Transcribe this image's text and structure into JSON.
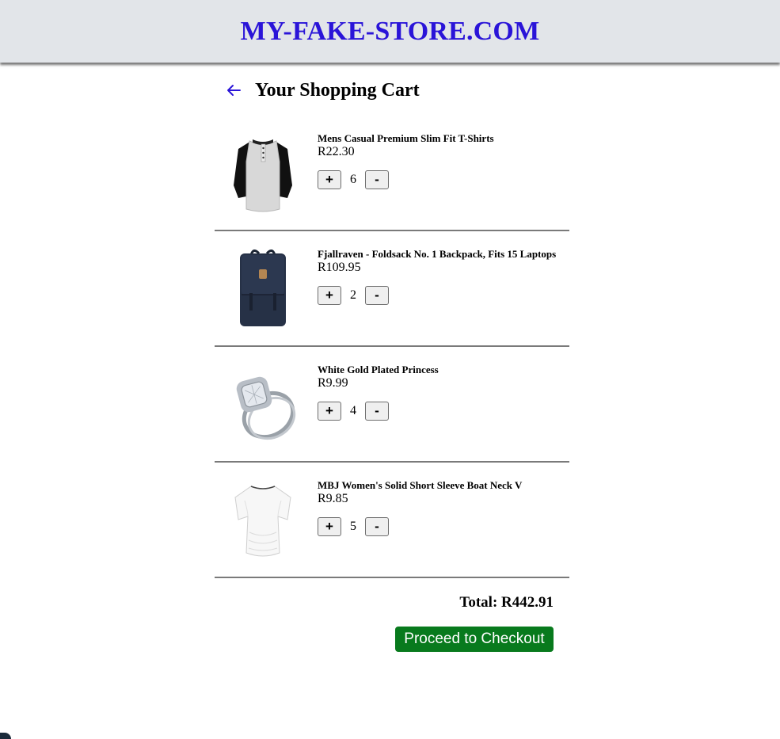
{
  "header": {
    "brand": "MY-FAKE-STORE.COM"
  },
  "cart": {
    "title": "Your Shopping Cart",
    "items": [
      {
        "name": "Mens Casual Premium Slim Fit T-Shirts",
        "price": "R22.30",
        "quantity": "6",
        "image": "raglan-henley-shirt"
      },
      {
        "name": "Fjallraven - Foldsack No. 1 Backpack, Fits 15 Laptops",
        "price": "R109.95",
        "quantity": "2",
        "image": "navy-backpack"
      },
      {
        "name": "White Gold Plated Princess",
        "price": "R9.99",
        "quantity": "4",
        "image": "diamond-ring"
      },
      {
        "name": "MBJ Women's Solid Short Sleeve Boat Neck V",
        "price": "R9.85",
        "quantity": "5",
        "image": "white-womens-top"
      }
    ],
    "plus_label": "+",
    "minus_label": "-",
    "total": "Total: R442.91",
    "checkout_label": "Proceed to Checkout"
  },
  "colors": {
    "brand": "#2a14d8",
    "header_bg": "#e2e5e9",
    "checkout_bg": "#087a1d",
    "divider": "#7a7a7a"
  },
  "icons": {
    "back": "arrow-left-icon"
  }
}
